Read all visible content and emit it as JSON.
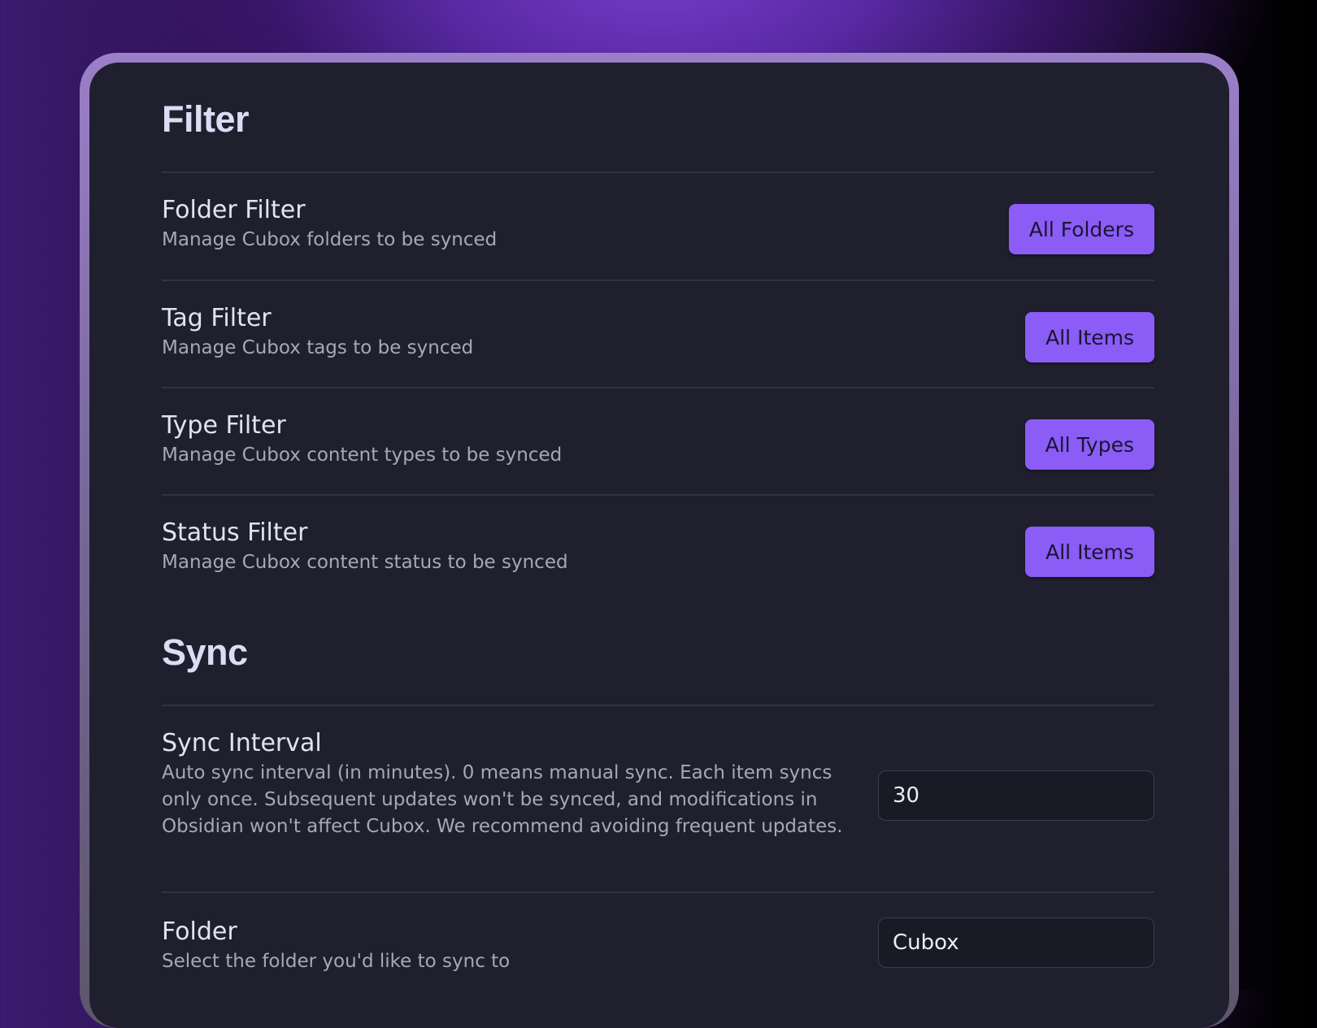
{
  "filter": {
    "title": "Filter",
    "rows": [
      {
        "name": "Folder Filter",
        "desc": "Manage Cubox folders to be synced",
        "button": "All Folders"
      },
      {
        "name": "Tag Filter",
        "desc": "Manage Cubox tags to be synced",
        "button": "All Items"
      },
      {
        "name": "Type Filter",
        "desc": "Manage Cubox content types to be synced",
        "button": "All Types"
      },
      {
        "name": "Status Filter",
        "desc": "Manage Cubox content status to be synced",
        "button": "All Items"
      }
    ]
  },
  "sync": {
    "title": "Sync",
    "interval": {
      "name": "Sync Interval",
      "desc": "Auto sync interval (in minutes). 0 means manual sync. Each item syncs only once. Subsequent updates won't be synced, and modifications in Obsidian won't affect Cubox. We recommend avoiding frequent updates.",
      "value": "30"
    },
    "folder": {
      "name": "Folder",
      "desc": "Select the folder you'd like to sync to",
      "value": "Cubox"
    }
  },
  "colors": {
    "accent": "#8b5cf6",
    "panel": "#1f1f2e",
    "text_primary": "#e3e3f0",
    "text_secondary": "#a7a7ba"
  }
}
